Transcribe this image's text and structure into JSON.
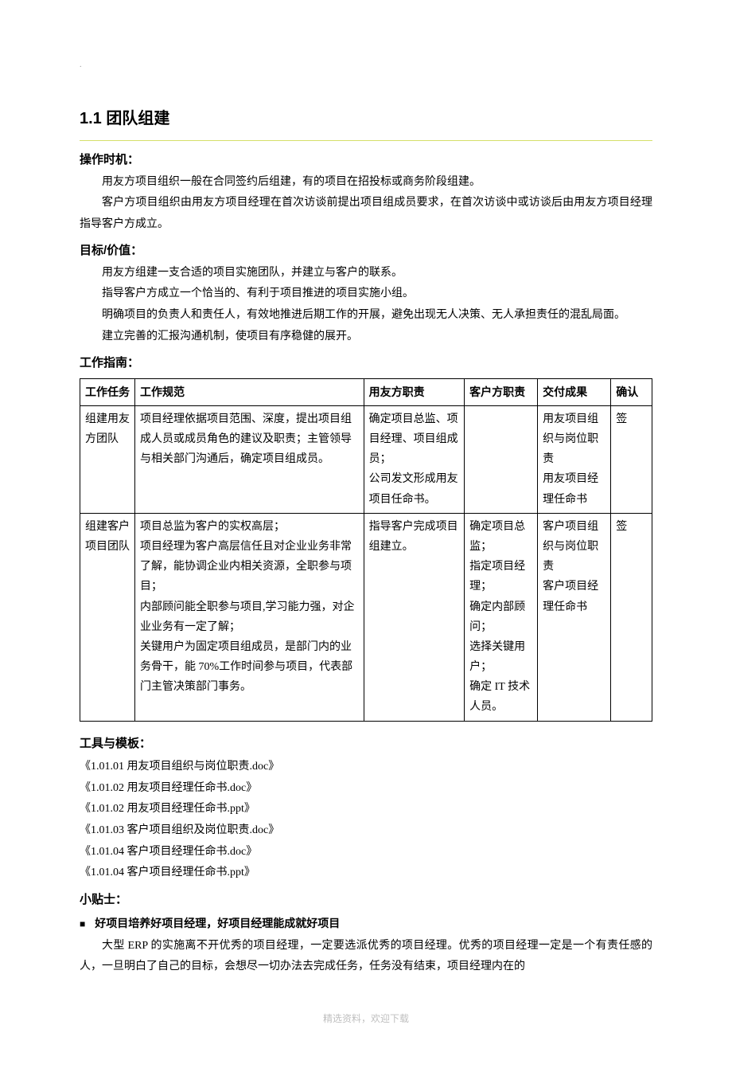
{
  "pageDot": ".",
  "sectionTitle": "1.1 团队组建",
  "opTime": {
    "heading": "操作时机：",
    "lines": [
      "用友方项目组织一般在合同签约后组建，有的项目在招投标或商务阶段组建。",
      "客户方项目组织由用友方项目经理在首次访谈前提出项目组成员要求，在首次访谈中或访谈后由用友方项目经理指导客户方成立。"
    ]
  },
  "goal": {
    "heading": "目标/价值：",
    "lines": [
      "用友方组建一支合适的项目实施团队，并建立与客户的联系。",
      "指导客户方成立一个恰当的、有利于项目推进的项目实施小组。",
      "明确项目的负责人和责任人，有效地推进后期工作的开展，避免出现无人决策、无人承担责任的混乱局面。",
      "建立完善的汇报沟通机制，使项目有序稳健的展开。"
    ]
  },
  "guide": {
    "heading": "工作指南：",
    "headers": {
      "task": "工作任务",
      "spec": "工作规范",
      "yf": "用友方职责",
      "kh": "客户方职责",
      "deliv": "交付成果",
      "conf": "确认"
    },
    "rows": [
      {
        "task": "组建用友方团队",
        "spec": "项目经理依据项目范围、深度，提出项目组成人员或成员角色的建议及职责；主管领导与相关部门沟通后，确定项目组成员。",
        "yf": "确定项目总监、项目经理、项目组成员；\n公司发文形成用友项目任命书。",
        "kh": "",
        "deliv": "用友项目组织与岗位职责\n用友项目经理任命书",
        "conf": "签"
      },
      {
        "task": "组建客户项目团队",
        "spec": "项目总监为客户的实权高层；\n项目经理为客户高层信任且对企业业务非常了解，能协调企业内相关资源，全职参与项目；\n内部顾问能全职参与项目,学习能力强，对企业业务有一定了解；\n关键用户为固定项目组成员，是部门内的业务骨干，能 70%工作时间参与项目，代表部门主管决策部门事务。",
        "yf": "指导客户完成项目组建立。",
        "kh": "确定项目总监；\n指定项目经理；\n确定内部顾问；\n选择关键用户；\n确定 IT 技术人员。",
        "deliv": "客户项目组织与岗位职责\n客户项目经理任命书",
        "conf": "签"
      }
    ]
  },
  "templates": {
    "heading": "工具与模板：",
    "items": [
      "《1.01.01 用友项目组织与岗位职责.doc》",
      "《1.01.02 用友项目经理任命书.doc》",
      "《1.01.02 用友项目经理任命书.ppt》",
      "《1.01.03 客户项目组织及岗位职责.doc》",
      "《1.01.04 客户项目经理任命书.doc》",
      "《1.01.04 客户项目经理任命书.ppt》"
    ]
  },
  "tips": {
    "heading": "小贴士：",
    "bullet": "好项目培养好项目经理，好项目经理能成就好项目",
    "para": "大型 ERP 的实施离不开优秀的项目经理，一定要选派优秀的项目经理。优秀的项目经理一定是一个有责任感的人，一旦明白了自己的目标，会想尽一切办法去完成任务，任务没有结束，项目经理内在的"
  },
  "footer": "精选资料，欢迎下载"
}
